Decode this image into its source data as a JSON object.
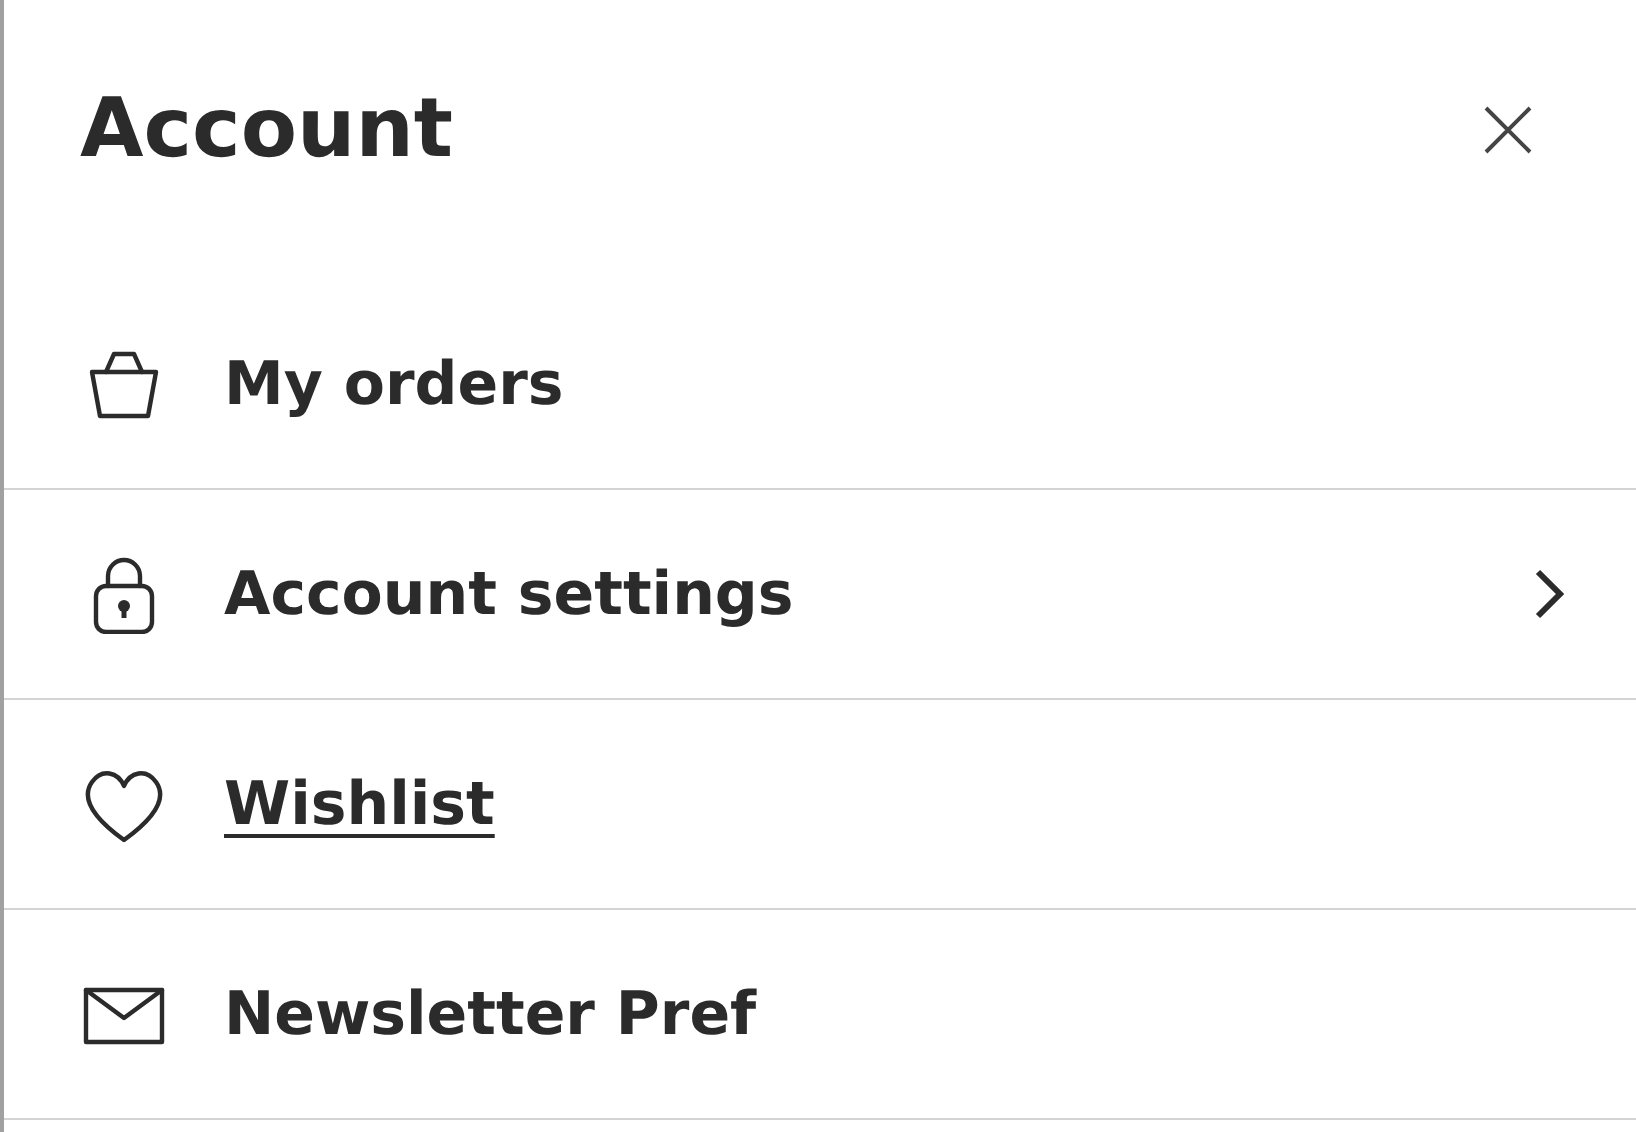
{
  "panel": {
    "title": "Account"
  },
  "items": [
    {
      "label": "My orders",
      "kind": "orders",
      "underlined": false,
      "chevron": false
    },
    {
      "label": "Account settings",
      "kind": "settings",
      "underlined": false,
      "chevron": true
    },
    {
      "label": "Wishlist",
      "kind": "wishlist",
      "underlined": true,
      "chevron": false
    },
    {
      "label": "Newsletter Pref",
      "kind": "newsletter",
      "underlined": false,
      "chevron": false
    }
  ]
}
